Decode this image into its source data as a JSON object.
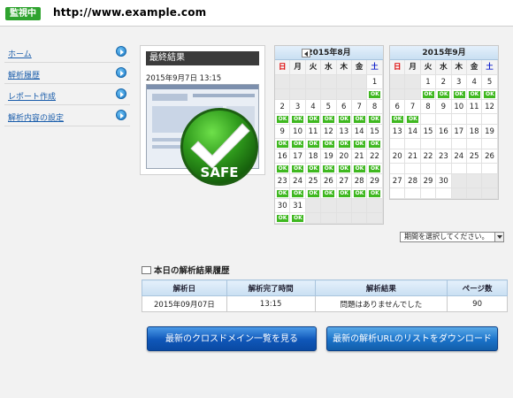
{
  "header": {
    "status_badge": "監視中",
    "url": "http://www.example.com"
  },
  "sidebar": {
    "items": [
      {
        "label": "ホーム"
      },
      {
        "label": "解析履歴"
      },
      {
        "label": "レポート作成"
      },
      {
        "label": "解析内容の設定"
      }
    ]
  },
  "result": {
    "title": "最終結果",
    "datetime": "2015年9月7日 13:15",
    "badge_text": "SAFE"
  },
  "calendars": [
    {
      "month_label": "2015年8月",
      "weekdays": [
        "日",
        "月",
        "火",
        "水",
        "木",
        "金",
        "土"
      ],
      "weeks": [
        [
          null,
          null,
          null,
          null,
          null,
          null,
          1
        ],
        [
          2,
          3,
          4,
          5,
          6,
          7,
          8
        ],
        [
          9,
          10,
          11,
          12,
          13,
          14,
          15
        ],
        [
          16,
          17,
          18,
          19,
          20,
          21,
          22
        ],
        [
          23,
          24,
          25,
          26,
          27,
          28,
          29
        ],
        [
          30,
          31,
          null,
          null,
          null,
          null,
          null
        ]
      ],
      "ok_days": [
        1,
        2,
        3,
        4,
        5,
        6,
        7,
        8,
        9,
        10,
        11,
        12,
        13,
        14,
        15,
        16,
        17,
        18,
        19,
        20,
        21,
        22,
        23,
        24,
        25,
        26,
        27,
        28,
        29,
        30,
        31
      ]
    },
    {
      "month_label": "2015年9月",
      "weekdays": [
        "日",
        "月",
        "火",
        "水",
        "木",
        "金",
        "土"
      ],
      "weeks": [
        [
          null,
          null,
          1,
          2,
          3,
          4,
          5
        ],
        [
          6,
          7,
          8,
          9,
          10,
          11,
          12
        ],
        [
          13,
          14,
          15,
          16,
          17,
          18,
          19
        ],
        [
          20,
          21,
          22,
          23,
          24,
          25,
          26
        ],
        [
          27,
          28,
          29,
          30,
          null,
          null,
          null
        ]
      ],
      "ok_days": [
        1,
        2,
        3,
        4,
        5,
        6,
        7
      ]
    }
  ],
  "ok_label": "OK",
  "period_select": {
    "placeholder": "期間を選択してください。"
  },
  "history": {
    "title": "本日の解析結果履歴",
    "headers": [
      "解析日",
      "解析完了時間",
      "解析結果",
      "ページ数"
    ],
    "rows": [
      [
        "2015年09月07日",
        "13:15",
        "問題はありませんでした",
        "90"
      ]
    ]
  },
  "buttons": {
    "cross_domain": "最新のクロスドメイン一覧を見る",
    "download": "最新の解析URLのリストをダウンロード"
  },
  "colors": {
    "badge_green": "#2fa32f",
    "ok_green": "#3fb820",
    "link_blue": "#1a5dab",
    "button_blue": "#0f56b8"
  }
}
